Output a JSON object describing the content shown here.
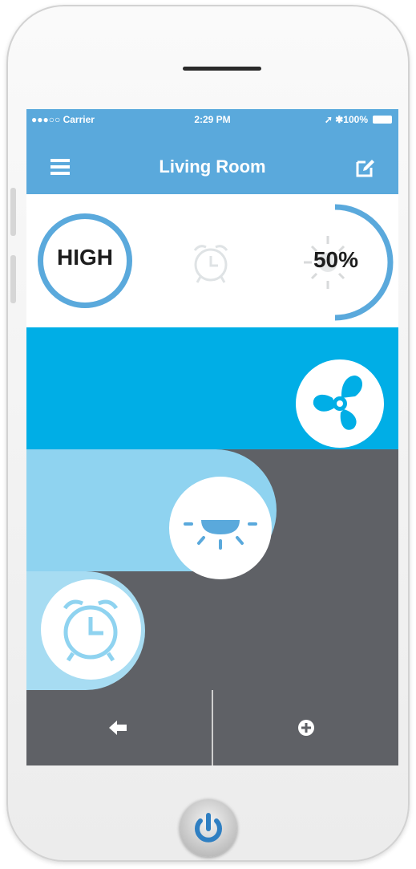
{
  "status": {
    "carrier": "●●●○○ Carrier",
    "time": "2:29 PM",
    "battery": "➚ ✱100%"
  },
  "nav": {
    "title": "Living Room",
    "menu_icon": "hamburger-menu-icon",
    "edit_icon": "edit-icon"
  },
  "controls": {
    "speed_label": "HIGH",
    "dim_label": "50%",
    "dim_level": 0.5,
    "alarm_icon": "alarm-clock-icon"
  },
  "bands": {
    "fan_icon": "fan-icon",
    "light_icon": "ceiling-light-icon",
    "alarm_icon": "alarm-clock-icon"
  },
  "bottom": {
    "back_icon": "arrow-left-icon",
    "add_icon": "plus-circle-icon"
  },
  "device": {
    "home_icon": "power-icon"
  },
  "colors": {
    "primary": "#5aa9dc",
    "fan_band": "#00aee6",
    "light_band": "#8fd3f0",
    "alarm_band": "#a7dcf2",
    "dark": "#5f6166"
  }
}
